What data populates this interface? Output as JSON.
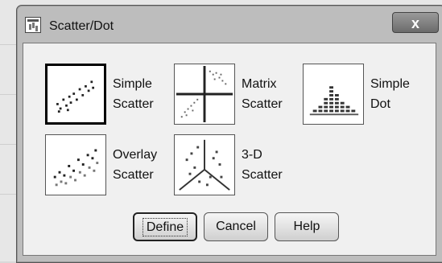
{
  "dialog": {
    "title": "Scatter/Dot",
    "close_label": "x"
  },
  "chart_types": [
    {
      "id": "simple-scatter",
      "line1": "Simple",
      "line2": "Scatter",
      "selected": true
    },
    {
      "id": "matrix-scatter",
      "line1": "Matrix",
      "line2": "Scatter",
      "selected": false
    },
    {
      "id": "simple-dot",
      "line1": "Simple",
      "line2": "Dot",
      "selected": false
    },
    {
      "id": "overlay-scatter",
      "line1": "Overlay",
      "line2": "Scatter",
      "selected": false
    },
    {
      "id": "3d-scatter",
      "line1": "3-D",
      "line2": "Scatter",
      "selected": false
    }
  ],
  "buttons": {
    "define": "Define",
    "cancel": "Cancel",
    "help": "Help"
  }
}
